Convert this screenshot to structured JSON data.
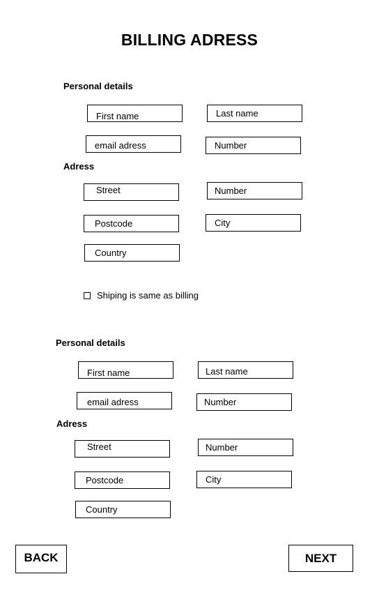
{
  "title": "BILLING ADRESS",
  "billing": {
    "personal_label": "Personal details",
    "address_label": "Adress",
    "first_name": "First name",
    "last_name": "Last name",
    "email": "email adress",
    "phone_number": "Number",
    "street": "Street",
    "street_number": "Number",
    "postcode": "Postcode",
    "city": "City",
    "country": "Country"
  },
  "same_as_billing": {
    "label": "Shiping is same as billing",
    "checked": false
  },
  "shipping": {
    "personal_label": "Personal details",
    "address_label": "Adress",
    "first_name": "First name",
    "last_name": "Last name",
    "email": "email adress",
    "phone_number": "Number",
    "street": "Street",
    "street_number": "Number",
    "postcode": "Postcode",
    "city": "City",
    "country": "Country"
  },
  "buttons": {
    "back": "BACK",
    "next": "NEXT"
  }
}
